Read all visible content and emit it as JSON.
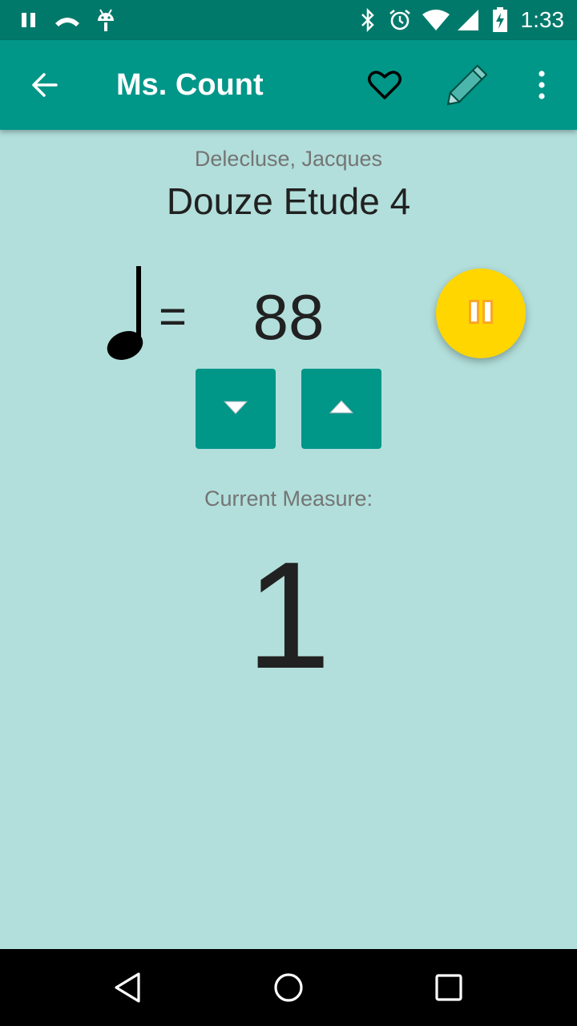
{
  "status_bar": {
    "time": "1:33",
    "icons": [
      "pause-icon",
      "missed-call-icon",
      "android-icon",
      "bluetooth-icon",
      "alarm-icon",
      "wifi-icon",
      "cell-signal-icon",
      "battery-charging-icon"
    ]
  },
  "app_bar": {
    "title": "Ms. Count",
    "actions": [
      "back-arrow-icon",
      "favorite-heart-icon",
      "edit-pencil-icon",
      "more-vert-icon"
    ]
  },
  "piece": {
    "composer": "Delecluse, Jacques",
    "title": "Douze Etude 4"
  },
  "tempo": {
    "note_icon": "quarter-note-icon",
    "equals": "=",
    "bpm": "88"
  },
  "controls": {
    "play_state": "playing",
    "fab_icon": "pause-icon",
    "decrease_icon": "triangle-down-icon",
    "increase_icon": "triangle-up-icon"
  },
  "measure": {
    "label": "Current Measure:",
    "value": "1"
  },
  "nav_bar": {
    "icons": [
      "back-triangle-icon",
      "home-circle-icon",
      "recents-square-icon"
    ]
  },
  "colors": {
    "status_bar": "#00796b",
    "app_bar": "#009688",
    "background": "#b2dfdb",
    "fab": "#ffd600",
    "buttons": "#009688"
  }
}
